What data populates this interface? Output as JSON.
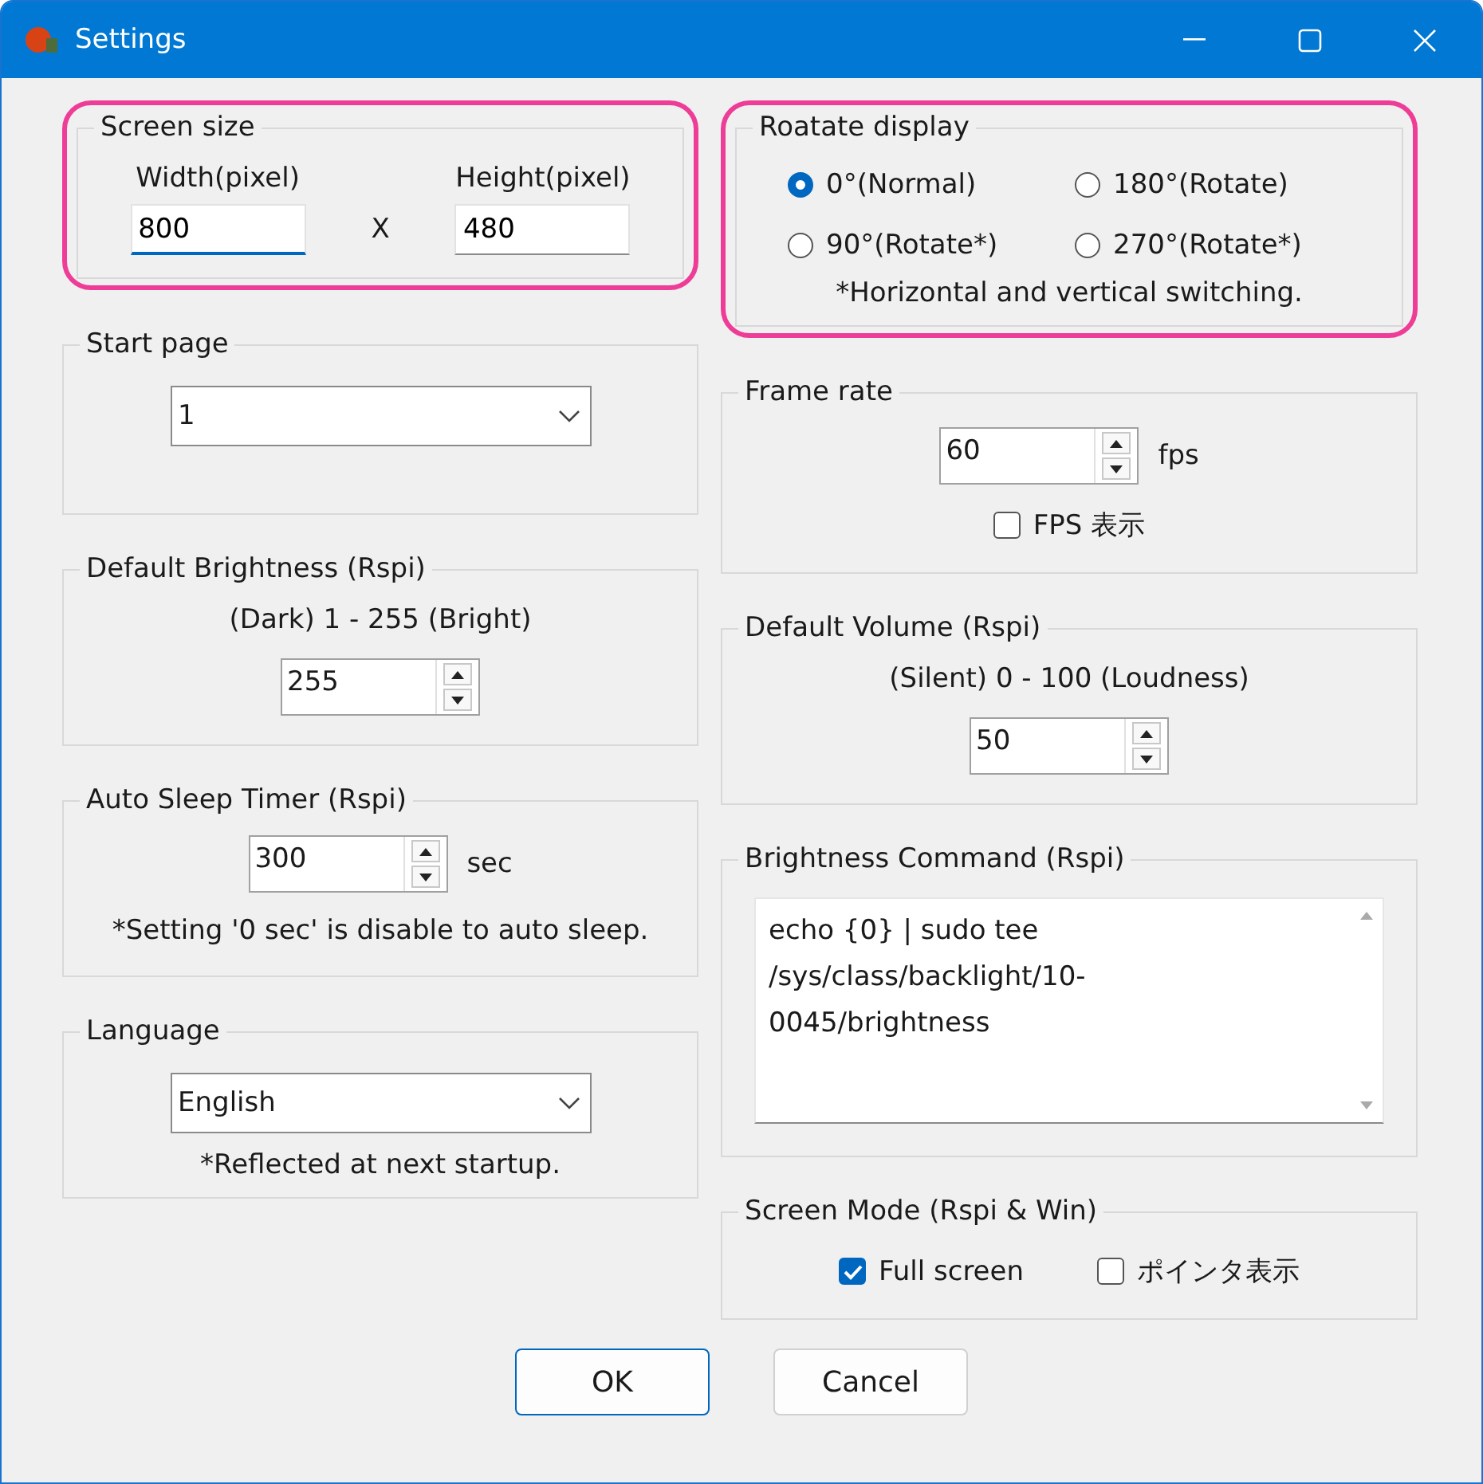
{
  "window": {
    "title": "Settings"
  },
  "left": [
    {
      "kind": "size",
      "title": "Screen size",
      "highlighted": true,
      "fields": [
        {
          "label": "Width(pixel)",
          "value": "800",
          "focused": true
        },
        {
          "label": "Height(pixel)",
          "value": "480",
          "focused": false
        }
      ],
      "separator": "X"
    },
    {
      "kind": "dropdown",
      "title": "Start page",
      "value": "1"
    },
    {
      "kind": "spinner",
      "title": "Default Brightness (Rspi)",
      "range": "(Dark) 1 - 255 (Bright)",
      "value": "255"
    },
    {
      "kind": "spinner",
      "title": "Auto Sleep Timer (Rspi)",
      "value": "300",
      "unit": "sec",
      "note": "*Setting '0 sec' is disable to auto sleep."
    },
    {
      "kind": "dropdown",
      "title": "Language",
      "value": "English",
      "note": "*Reflected at next startup."
    }
  ],
  "right": [
    {
      "kind": "radios",
      "title": "Roatate display",
      "highlighted": true,
      "options": [
        {
          "label": "0°(Normal)",
          "selected": true
        },
        {
          "label": "180°(Rotate)",
          "selected": false
        },
        {
          "label": "90°(Rotate*)",
          "selected": false
        },
        {
          "label": "270°(Rotate*)",
          "selected": false
        }
      ],
      "note": "*Horizontal and vertical switching."
    },
    {
      "kind": "spinner",
      "title": "Frame rate",
      "value": "60",
      "unit": "fps",
      "checks": [
        {
          "label": "FPS 表示",
          "checked": false
        }
      ]
    },
    {
      "kind": "spinner",
      "title": "Default Volume (Rspi)",
      "range": "(Silent) 0 - 100 (Loudness)",
      "value": "50"
    },
    {
      "kind": "textarea",
      "title": "Brightness Command (Rspi)",
      "lines": [
        "echo {0} | sudo tee",
        "/sys/class/backlight/10-",
        "0045/brightness"
      ]
    },
    {
      "kind": "checks",
      "title": "Screen Mode  (Rspi & Win)",
      "checks": [
        {
          "label": "Full screen",
          "checked": true
        },
        {
          "label": "ポインタ表示",
          "checked": false
        }
      ]
    }
  ],
  "buttons": [
    {
      "label": "OK",
      "default": true
    },
    {
      "label": "Cancel",
      "default": false
    }
  ]
}
